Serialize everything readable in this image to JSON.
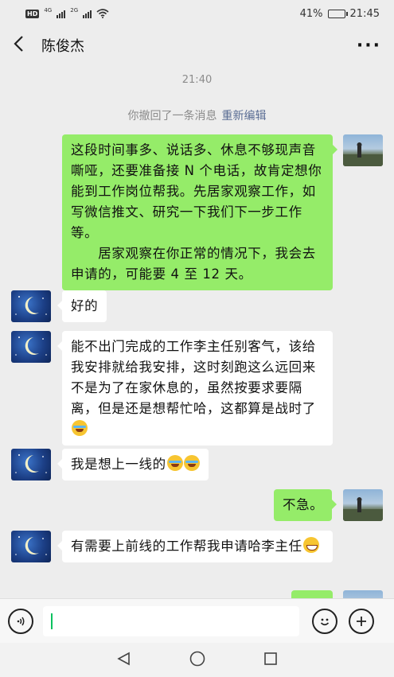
{
  "status_bar": {
    "hd_label": "HD",
    "net1": "4G",
    "net2": "2G",
    "battery": "41%",
    "battery_level": 0.41,
    "clock": "21:45"
  },
  "header": {
    "back_icon": "chevron-left-icon",
    "title": "陈俊杰",
    "more_icon": "more-dots-icon",
    "more_glyph": "···"
  },
  "chat": {
    "time_label": "21:40",
    "recall_notice": "你撤回了一条消息",
    "recall_edit": "重新编辑",
    "messages": [
      {
        "from": "me",
        "text": "这段时间事多、说话多、休息不够现声音嘶哑，还要准备接 N 个电话，故肯定想你能到工作岗位帮我。先居家观察工作，如写微信推文、研究一下我们下一步工作等。\n　　居家观察在你正常的情况下，我会去申请的，可能要 4 至 12 天。"
      },
      {
        "from": "them",
        "text": "好的"
      },
      {
        "from": "them",
        "text": "能不出门完成的工作李主任别客气，该给我安排就给我安排，这时刻跑这么远回来不是为了在家休息的，虽然按要求要隔离，但是还是想帮忙哈，这都算是战时了"
      },
      {
        "from": "them",
        "text": "我是想上一线的"
      },
      {
        "from": "me",
        "text": "不急。"
      },
      {
        "from": "them",
        "text": "有需要上前线的工作帮我申请哈李主任"
      }
    ]
  },
  "input_bar": {
    "voice_icon": "voice-icon",
    "emoji_icon": "emoji-icon",
    "plus_icon": "plus-icon"
  },
  "nav": {
    "back": "nav-back-icon",
    "home": "nav-home-icon",
    "recent": "nav-recent-icon"
  },
  "colors": {
    "background": "#ededed",
    "my_bubble": "#95ec69",
    "their_bubble": "#ffffff",
    "link": "#5a6d94",
    "caret": "#07c160"
  }
}
